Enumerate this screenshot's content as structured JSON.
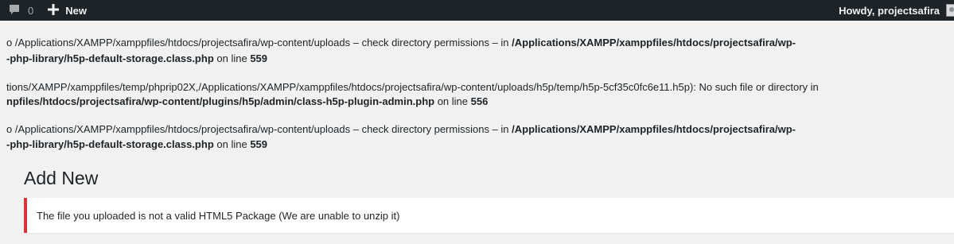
{
  "adminbar": {
    "comments_count": "0",
    "new_label": "New",
    "howdy": "Howdy, projectsafira",
    "icons": {
      "comments": "speech-bubble-icon",
      "new": "plus-icon",
      "avatar": "avatar-icon"
    },
    "colors": {
      "background": "#1d2327",
      "text": "#f0f0f1"
    }
  },
  "warnings": [
    {
      "line1_text": "o /Applications/XAMPP/xamppfiles/htdocs/projectsafira/wp-content/uploads – check directory permissions – in ",
      "line1_bold": "/Applications/XAMPP/xamppfiles/htdocs/projectsafira/wp-",
      "line2_bold": "-php-library/h5p-default-storage.class.php",
      "line2_text": " on line ",
      "line2_num": "559"
    },
    {
      "line1_text": "tions/XAMPP/xamppfiles/temp/phprip02X,/Applications/XAMPP/xamppfiles/htdocs/projectsafira/wp-content/uploads/h5p/temp/h5p-5cf35c0fc6e11.h5p): No such file or directory in",
      "line2_bold": "npfiles/htdocs/projectsafira/wp-content/plugins/h5p/admin/class-h5p-plugin-admin.php",
      "line2_text": " on line ",
      "line2_num": "556"
    },
    {
      "line1_text": "o /Applications/XAMPP/xamppfiles/htdocs/projectsafira/wp-content/uploads – check directory permissions – in ",
      "line1_bold": "/Applications/XAMPP/xamppfiles/htdocs/projectsafira/wp-",
      "line2_bold": "-php-library/h5p-default-storage.class.php",
      "line2_text": " on line ",
      "line2_num": "559"
    }
  ],
  "page_title": "Add New",
  "notice": {
    "message": "The file you uploaded is not a valid HTML5 Package (We are unable to unzip it)",
    "border_color": "#d63638"
  }
}
